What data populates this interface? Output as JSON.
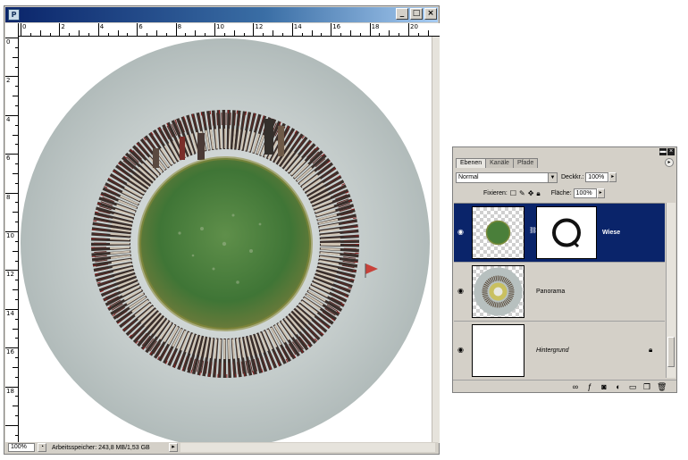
{
  "document_window": {
    "app_icon": "photoshop-icon",
    "window_buttons": [
      {
        "name": "minimize-button",
        "glyph": "_"
      },
      {
        "name": "maximize-button",
        "glyph": "□"
      },
      {
        "name": "close-button",
        "glyph": "×"
      }
    ],
    "ruler_horizontal_labels": [
      "0",
      "2",
      "4",
      "6",
      "8",
      "10",
      "12",
      "14",
      "16",
      "18",
      "20"
    ],
    "ruler_vertical_labels": [
      "0",
      "2",
      "4",
      "6",
      "8",
      "10",
      "12",
      "14",
      "16",
      "18"
    ],
    "status": {
      "zoom": "100%",
      "info": "Arbeitsspeicher: 243,8 MB/1,53 GB",
      "menu_arrow": "▸"
    }
  },
  "layers_panel": {
    "tabs": [
      "Ebenen",
      "Kanäle",
      "Pfade"
    ],
    "active_tab": 0,
    "blend_mode": "Normal",
    "opacity_label": "Deckkr.:",
    "opacity_value": "100%",
    "lock_label": "Fixieren:",
    "fill_label": "Fläche:",
    "fill_value": "100%",
    "layers": [
      {
        "name": "Wiese",
        "selected": true,
        "has_mask": true
      },
      {
        "name": "Panorama",
        "selected": false,
        "has_mask": false
      },
      {
        "name": "Hintergrund",
        "selected": false,
        "has_mask": false,
        "italic": true,
        "locked": true
      }
    ],
    "footer_icons": [
      "link-icon",
      "layer-style-icon",
      "mask-icon",
      "adjustment-icon",
      "group-icon",
      "new-layer-icon",
      "trash-icon"
    ]
  },
  "colors": {
    "selection": "#0a246a",
    "panel_bg": "#d4d0c8",
    "disc_gray": "#b7c0bf",
    "grass_green": "#4a7f3a"
  }
}
